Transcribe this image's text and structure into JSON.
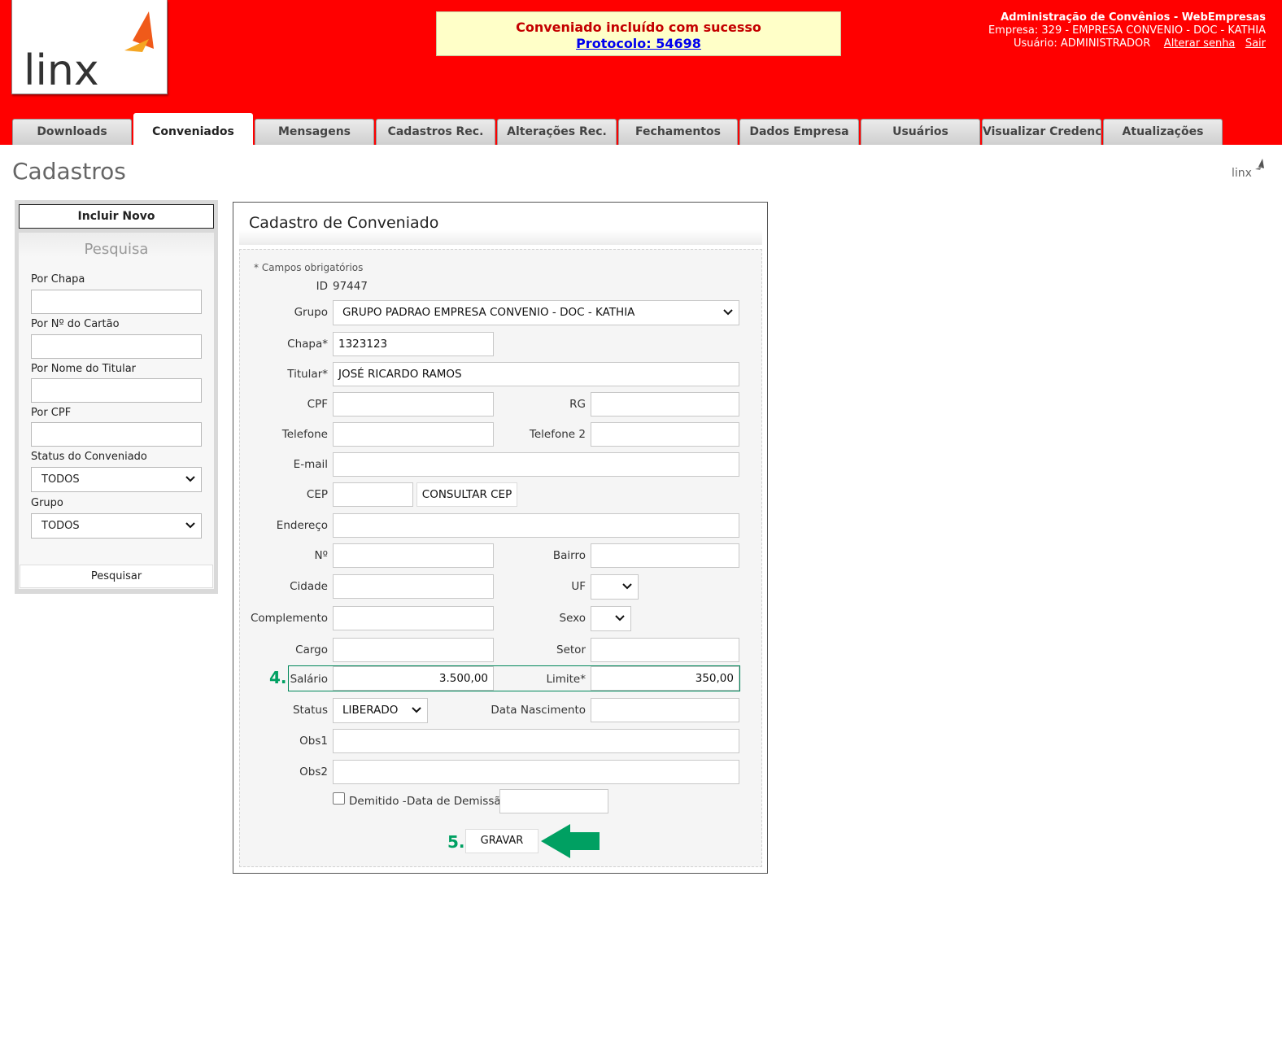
{
  "header": {
    "logo_text": "linx",
    "message": "Conveniado incluído com sucesso",
    "protocol_link": "Protocolo: 54698",
    "admin_title": "Administração de Convênios - WebEmpresas",
    "empresa": "Empresa: 329 - EMPRESA CONVENIO - DOC - KATHIA",
    "usuario": "Usuário: ADMINISTRADOR",
    "alterar_senha": "Alterar senha",
    "sair": "Sair",
    "brand_color": "#ff0000"
  },
  "tabs": [
    {
      "label": "Downloads",
      "active": false
    },
    {
      "label": "Conveniados",
      "active": true
    },
    {
      "label": "Mensagens",
      "active": false
    },
    {
      "label": "Cadastros Rec.",
      "active": false
    },
    {
      "label": "Alterações Rec.",
      "active": false
    },
    {
      "label": "Fechamentos",
      "active": false
    },
    {
      "label": "Dados Empresa",
      "active": false
    },
    {
      "label": "Usuários",
      "active": false
    },
    {
      "label": "Visualizar Credencial",
      "active": false
    },
    {
      "label": "Atualizações",
      "active": false
    }
  ],
  "page_title": "Cadastros",
  "sidebar": {
    "incluir_novo": "Incluir Novo",
    "search_title": "Pesquisa",
    "por_chapa": "Por Chapa",
    "por_cartao": "Por Nº do Cartão",
    "por_nome": "Por Nome do Titular",
    "por_cpf": "Por CPF",
    "status_label": "Status do Conveniado",
    "status_value": "TODOS",
    "grupo_label": "Grupo",
    "grupo_value": "TODOS",
    "pesquisar": "Pesquisar"
  },
  "form": {
    "title": "Cadastro de Conveniado",
    "required_note": "* Campos obrigatórios",
    "id_label": "ID",
    "id_value": "97447",
    "grupo_label": "Grupo",
    "grupo_value": "GRUPO PADRAO EMPRESA CONVENIO - DOC - KATHIA",
    "chapa_label": "Chapa*",
    "chapa_value": "1323123",
    "titular_label": "Titular*",
    "titular_value": "JOSÉ RICARDO RAMOS",
    "cpf_label": "CPF",
    "rg_label": "RG",
    "telefone_label": "Telefone",
    "telefone2_label": "Telefone 2",
    "email_label": "E-mail",
    "cep_label": "CEP",
    "consultar_cep": "CONSULTAR CEP",
    "endereco_label": "Endereço",
    "numero_label": "Nº",
    "bairro_label": "Bairro",
    "cidade_label": "Cidade",
    "uf_label": "UF",
    "complemento_label": "Complemento",
    "sexo_label": "Sexo",
    "cargo_label": "Cargo",
    "setor_label": "Setor",
    "salario_label": "Salário",
    "salario_value": "3.500,00",
    "limite_label": "Limite*",
    "limite_value": "350,00",
    "status_label": "Status",
    "status_value": "LIBERADO",
    "nascimento_label": "Data Nascimento",
    "obs1_label": "Obs1",
    "obs2_label": "Obs2",
    "demitido_label": "Demitido -",
    "demissao_label": "Data de Demissão",
    "gravar": "GRAVAR",
    "step4": "4.",
    "step5": "5.",
    "accent_color": "#00a062"
  },
  "icons": {
    "dropdown": "chevron-down-icon",
    "arrow": "left-arrow-icon"
  }
}
